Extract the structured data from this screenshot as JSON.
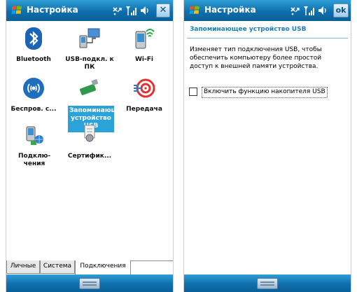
{
  "left": {
    "title": "Настройка",
    "close_label": "✕",
    "tiles": [
      {
        "name": "bluetooth",
        "label": "Bluetooth"
      },
      {
        "name": "usb-pc",
        "label": "USB-подкл. к ПК"
      },
      {
        "name": "wifi",
        "label": "Wi-Fi"
      },
      {
        "name": "wireless",
        "label": "Беспров. с..."
      },
      {
        "name": "usb-storage",
        "label": "Запоминающее устройство USB"
      },
      {
        "name": "beam",
        "label": "Передача"
      },
      {
        "name": "connections",
        "label": "Подклю-чения"
      },
      {
        "name": "certificates",
        "label": "Сертифик..."
      }
    ],
    "tabs": [
      "Личные",
      "Система",
      "Подключения"
    ],
    "active_tab": "Подключения"
  },
  "right": {
    "title": "Настройка",
    "ok_label": "ok",
    "section_title": "Запоминающее устройство USB",
    "description": "Изменяет тип подключения USB, чтобы обеспечить компьютеру более простой доступ к внешней памяти устройства.",
    "checkbox_label": "Включить функцию накопителя USB",
    "checkbox_checked": false
  },
  "colors": {
    "titlebar": "#1e87c4",
    "selection": "#2ba3d8",
    "section_text": "#1a7fb8"
  },
  "icons": [
    "windows-logo-icon",
    "connectivity-icon",
    "signal-icon",
    "volume-icon",
    "keyboard-icon"
  ]
}
